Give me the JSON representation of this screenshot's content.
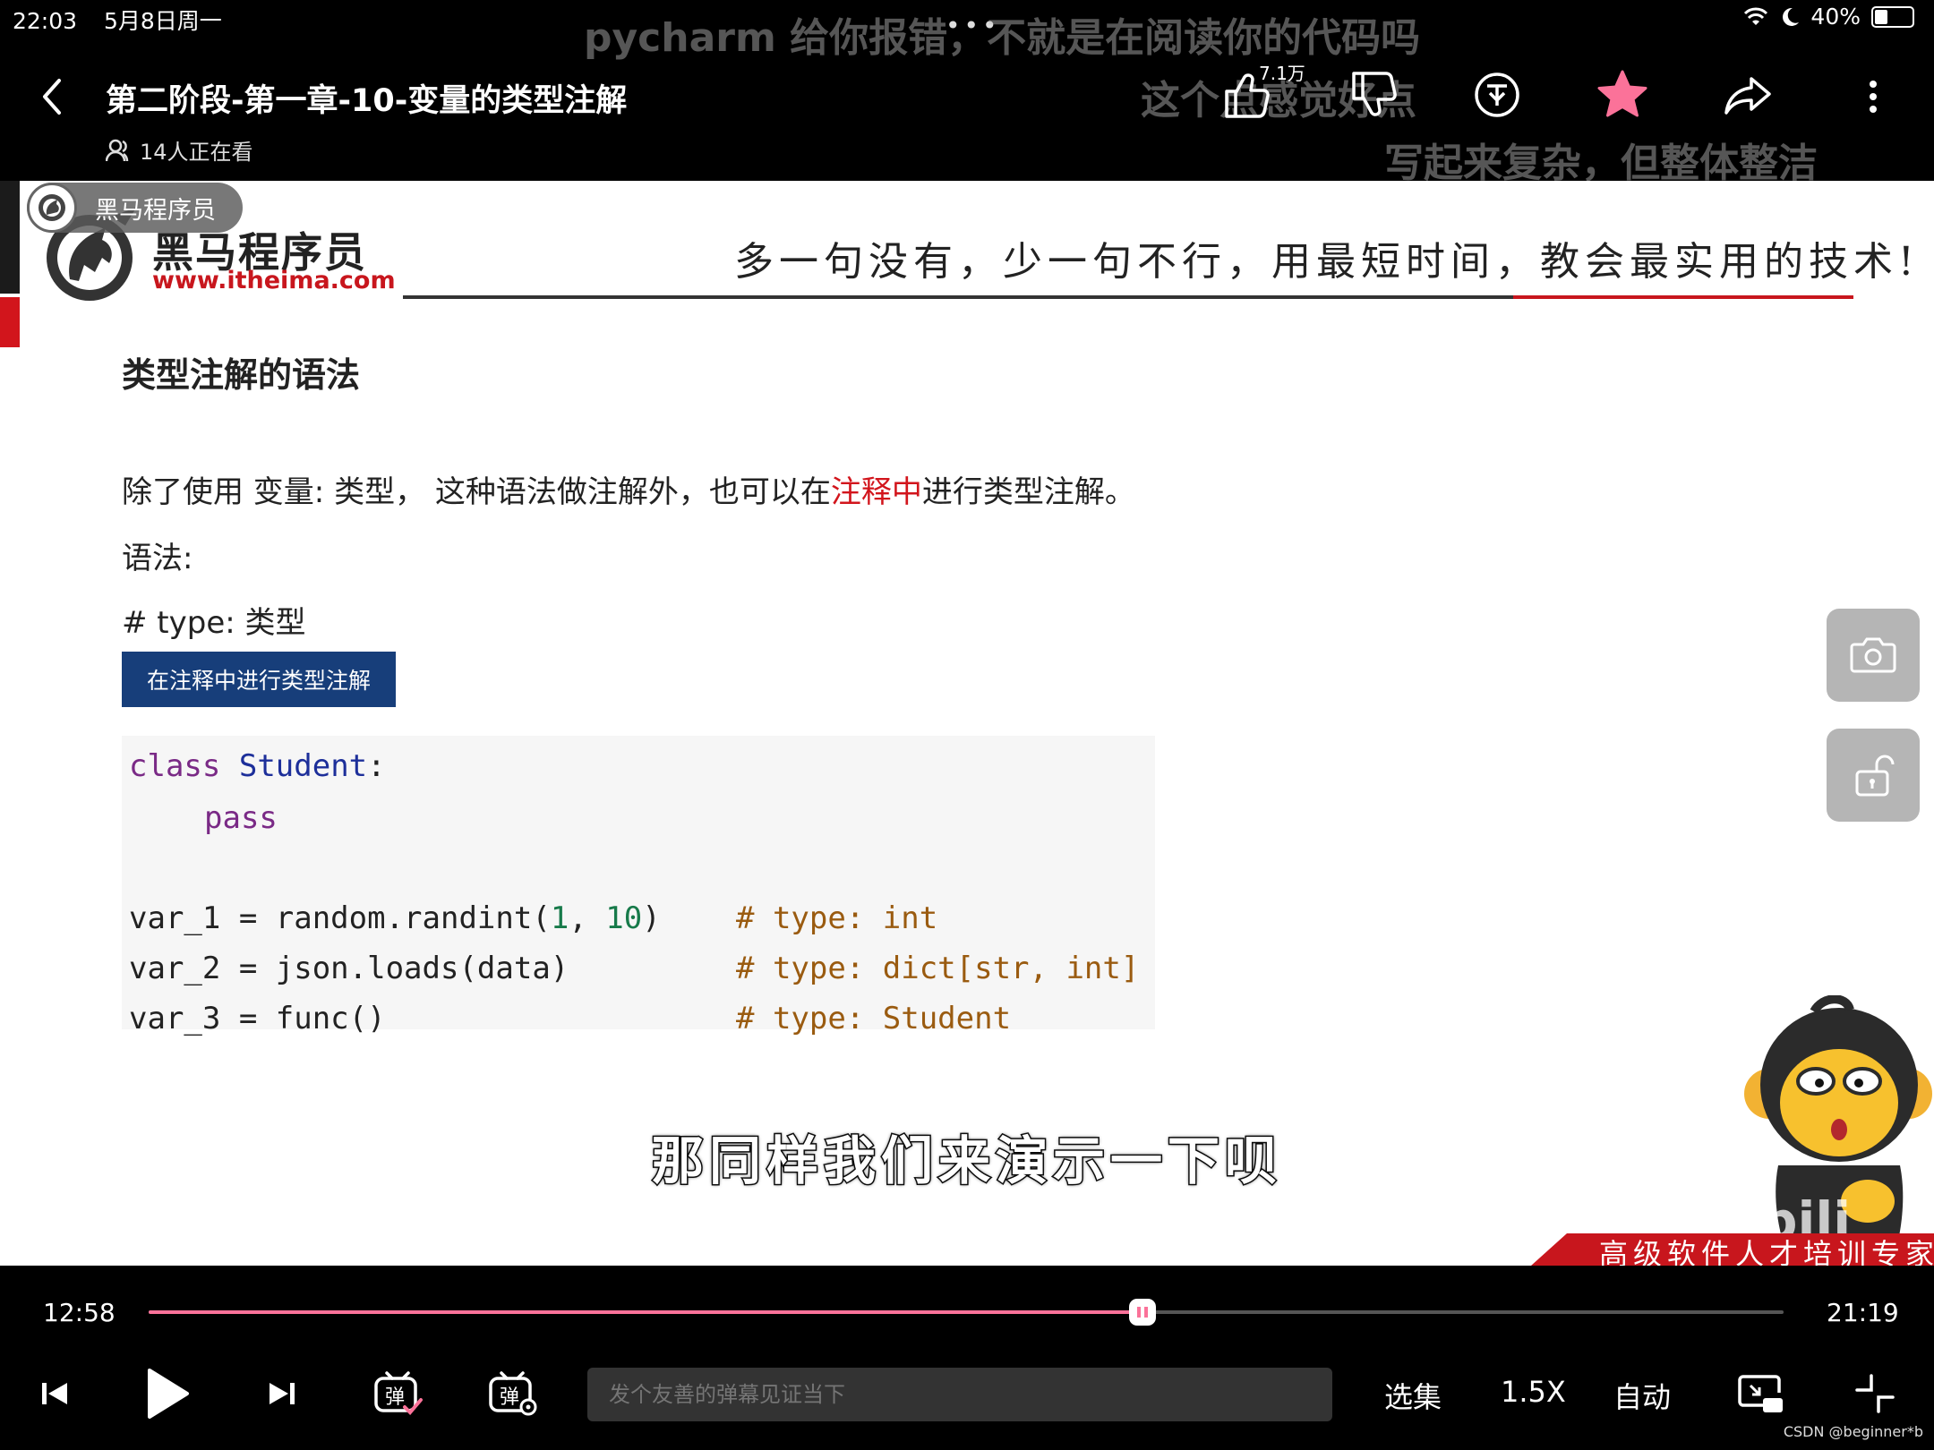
{
  "status_bar": {
    "time": "22:03",
    "date": "5月8日周一",
    "battery": "40%",
    "battery_level": 0.4
  },
  "danmaku": [
    "pycharm 给你报错，不就是在阅读你的代码吗",
    "这个点感觉好点",
    "写起来复杂，但整体整洁"
  ],
  "header": {
    "title": "第二阶段-第一章-10-变量的类型注解",
    "viewers": "14人正在看",
    "like_count": "7.1万"
  },
  "video": {
    "channel_badge": "黑马程序员",
    "brand_name": "黑马程序员",
    "brand_url": "www.itheima.com",
    "slogan": "多一句没有，少一句不行，用最短时间，教会最实用的技术!",
    "heading": "类型注解的语法",
    "line1_a": "除了使用 变量: 类型， 这种语法做注解外，也可以在",
    "line1_red": "注释中",
    "line1_b": "进行类型注解。",
    "line2": "语法:",
    "line3": "# type: 类型",
    "blue_label": "在注释中进行类型注解",
    "code": {
      "l1_kw": "class",
      "l1_cls": "Student",
      "l1_colon": ":",
      "l2_kw": "pass",
      "l3_code": "var_1 = random.randint(",
      "l3_n1": "1",
      "l3_sep": ", ",
      "l3_n2": "10",
      "l3_close": ")",
      "l3_cmt": "# type: int",
      "l4_code": "var_2 = json.loads(data)",
      "l4_cmt": "# type: dict[str, int]",
      "l5_code": "var_3 = func()",
      "l5_cmt": "# type: Student"
    },
    "subtitle": "那同样我们来演示一下呗",
    "bottom_strip": "高级软件人才培训专家"
  },
  "player": {
    "current_time": "12:58",
    "total_time": "21:19",
    "progress": 0.608,
    "danmaku_placeholder": "发个友善的弹幕见证当下",
    "episodes_label": "选集",
    "speed_label": "1.5X",
    "quality_label": "自动"
  },
  "watermark": "CSDN @beginner*b",
  "colors": {
    "accent_pink": "#fb7299",
    "brand_red": "#c8161d",
    "label_blue": "#173e7a"
  }
}
